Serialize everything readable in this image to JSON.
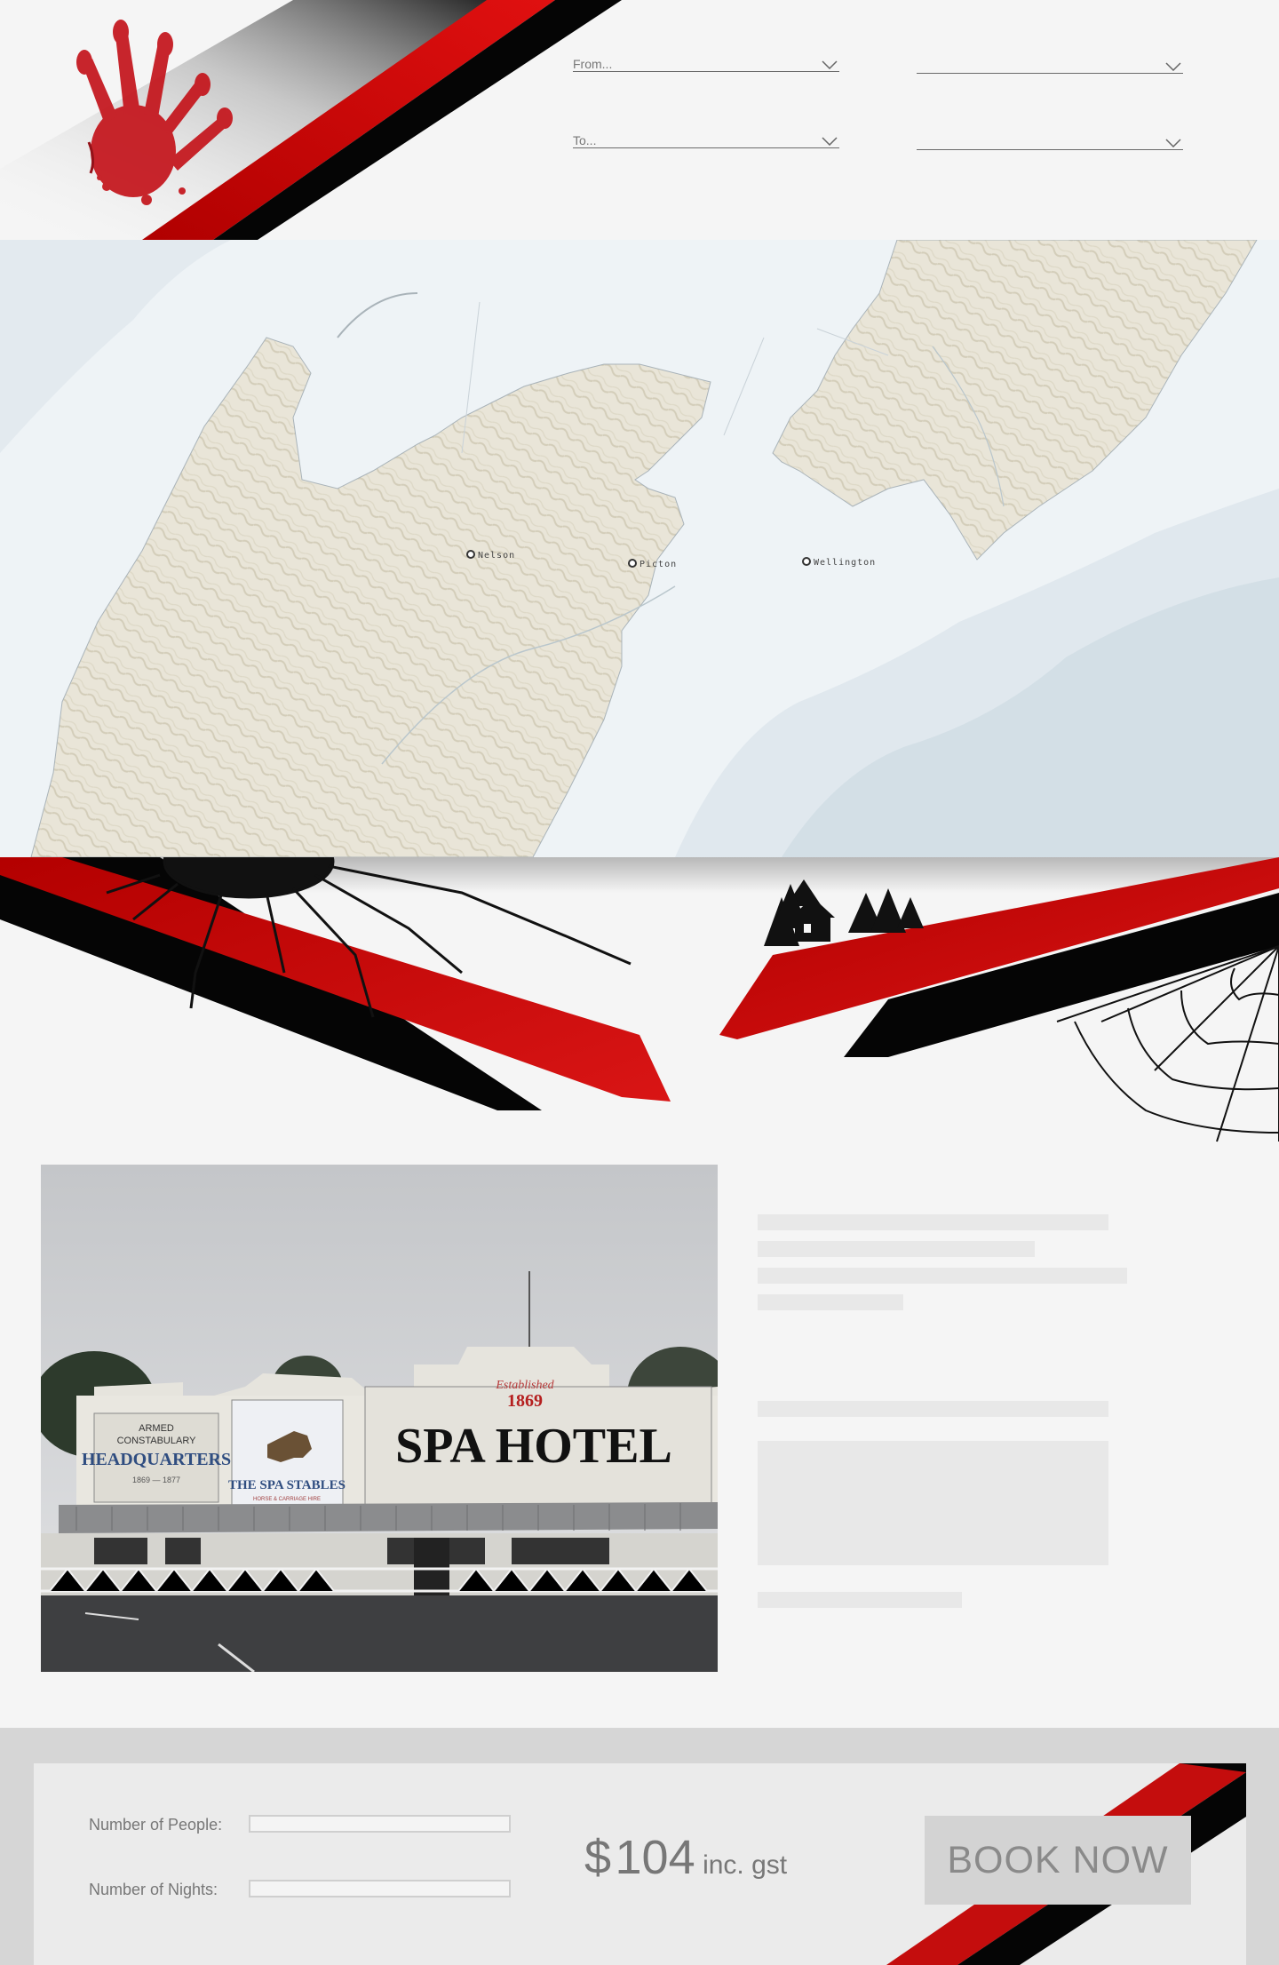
{
  "header": {
    "logo_icon": "bloody-handprint-icon",
    "route": {
      "from_label": "From...",
      "to_label": "To...",
      "from_second_label": "",
      "to_second_label": ""
    }
  },
  "map": {
    "places": [
      {
        "name": "Nelson"
      },
      {
        "name": "Picton"
      },
      {
        "name": "Wellington"
      }
    ]
  },
  "divider": {
    "decor": [
      "spider-icon",
      "haunted-house-icon",
      "pine-trees-icon",
      "spider-web-icon"
    ]
  },
  "hotel": {
    "photo": {
      "signs": {
        "established": "Established",
        "year": "1869",
        "name": "SPA HOTEL",
        "left_sign_line1": "ARMED",
        "left_sign_line2": "CONSTABULARY",
        "left_sign_line3": "HEADQUARTERS",
        "left_sign_years": "1869 — 1877",
        "middle_sign": "THE SPA STABLES",
        "middle_sign_sub": "HORSE & CARRIAGE HIRE"
      }
    }
  },
  "booking": {
    "people_label": "Number of People:",
    "nights_label": "Number of Nights:",
    "people_value": "",
    "nights_value": "",
    "currency": "$",
    "price": "104",
    "price_suffix": "inc. gst",
    "book_label": "BOOK NOW"
  },
  "colors": {
    "accent_red": "#c40d0d",
    "accent_black": "#050505",
    "land": "#e8e4d6",
    "sea": "#d9e4ea"
  }
}
